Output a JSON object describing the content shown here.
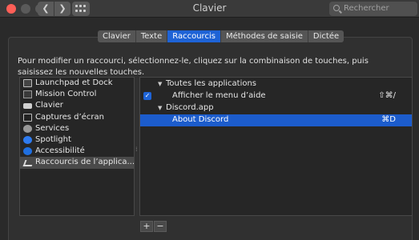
{
  "window": {
    "title": "Clavier",
    "search_placeholder": "Rechercher",
    "back_label": "❮",
    "forward_label": "❯"
  },
  "tabs": [
    {
      "label": "Clavier",
      "active": false
    },
    {
      "label": "Texte",
      "active": false
    },
    {
      "label": "Raccourcis",
      "active": true
    },
    {
      "label": "Méthodes de saisie",
      "active": false
    },
    {
      "label": "Dictée",
      "active": false
    }
  ],
  "description": "Pour modifier un raccourci, sélectionnez-le, cliquez sur la combinaison de touches, puis saisissez les nouvelles touches.",
  "categories": [
    {
      "label": "Launchpad et Dock",
      "icon": "monitor-icon"
    },
    {
      "label": "Mission Control",
      "icon": "mission-control-icon"
    },
    {
      "label": "Clavier",
      "icon": "keyboard-icon"
    },
    {
      "label": "Captures d’écran",
      "icon": "screenshot-icon"
    },
    {
      "label": "Services",
      "icon": "gear-icon"
    },
    {
      "label": "Spotlight",
      "icon": "spotlight-icon"
    },
    {
      "label": "Accessibilité",
      "icon": "accessibility-icon"
    },
    {
      "label": "Raccourcis de l’applica...",
      "icon": "app-shortcuts-icon",
      "selected": true
    }
  ],
  "shortcuts": {
    "group_all": "Toutes les applications",
    "help_menu_label": "Afficher le menu d’aide",
    "help_menu_key": "⇧⌘/",
    "help_menu_checked": true,
    "group_discord": "Discord.app",
    "about_label": "About Discord",
    "about_key": "⌘D"
  },
  "buttons": {
    "add": "+",
    "remove": "−"
  },
  "colors": {
    "accent": "#1e63d6",
    "selection": "#1c5ccc"
  }
}
